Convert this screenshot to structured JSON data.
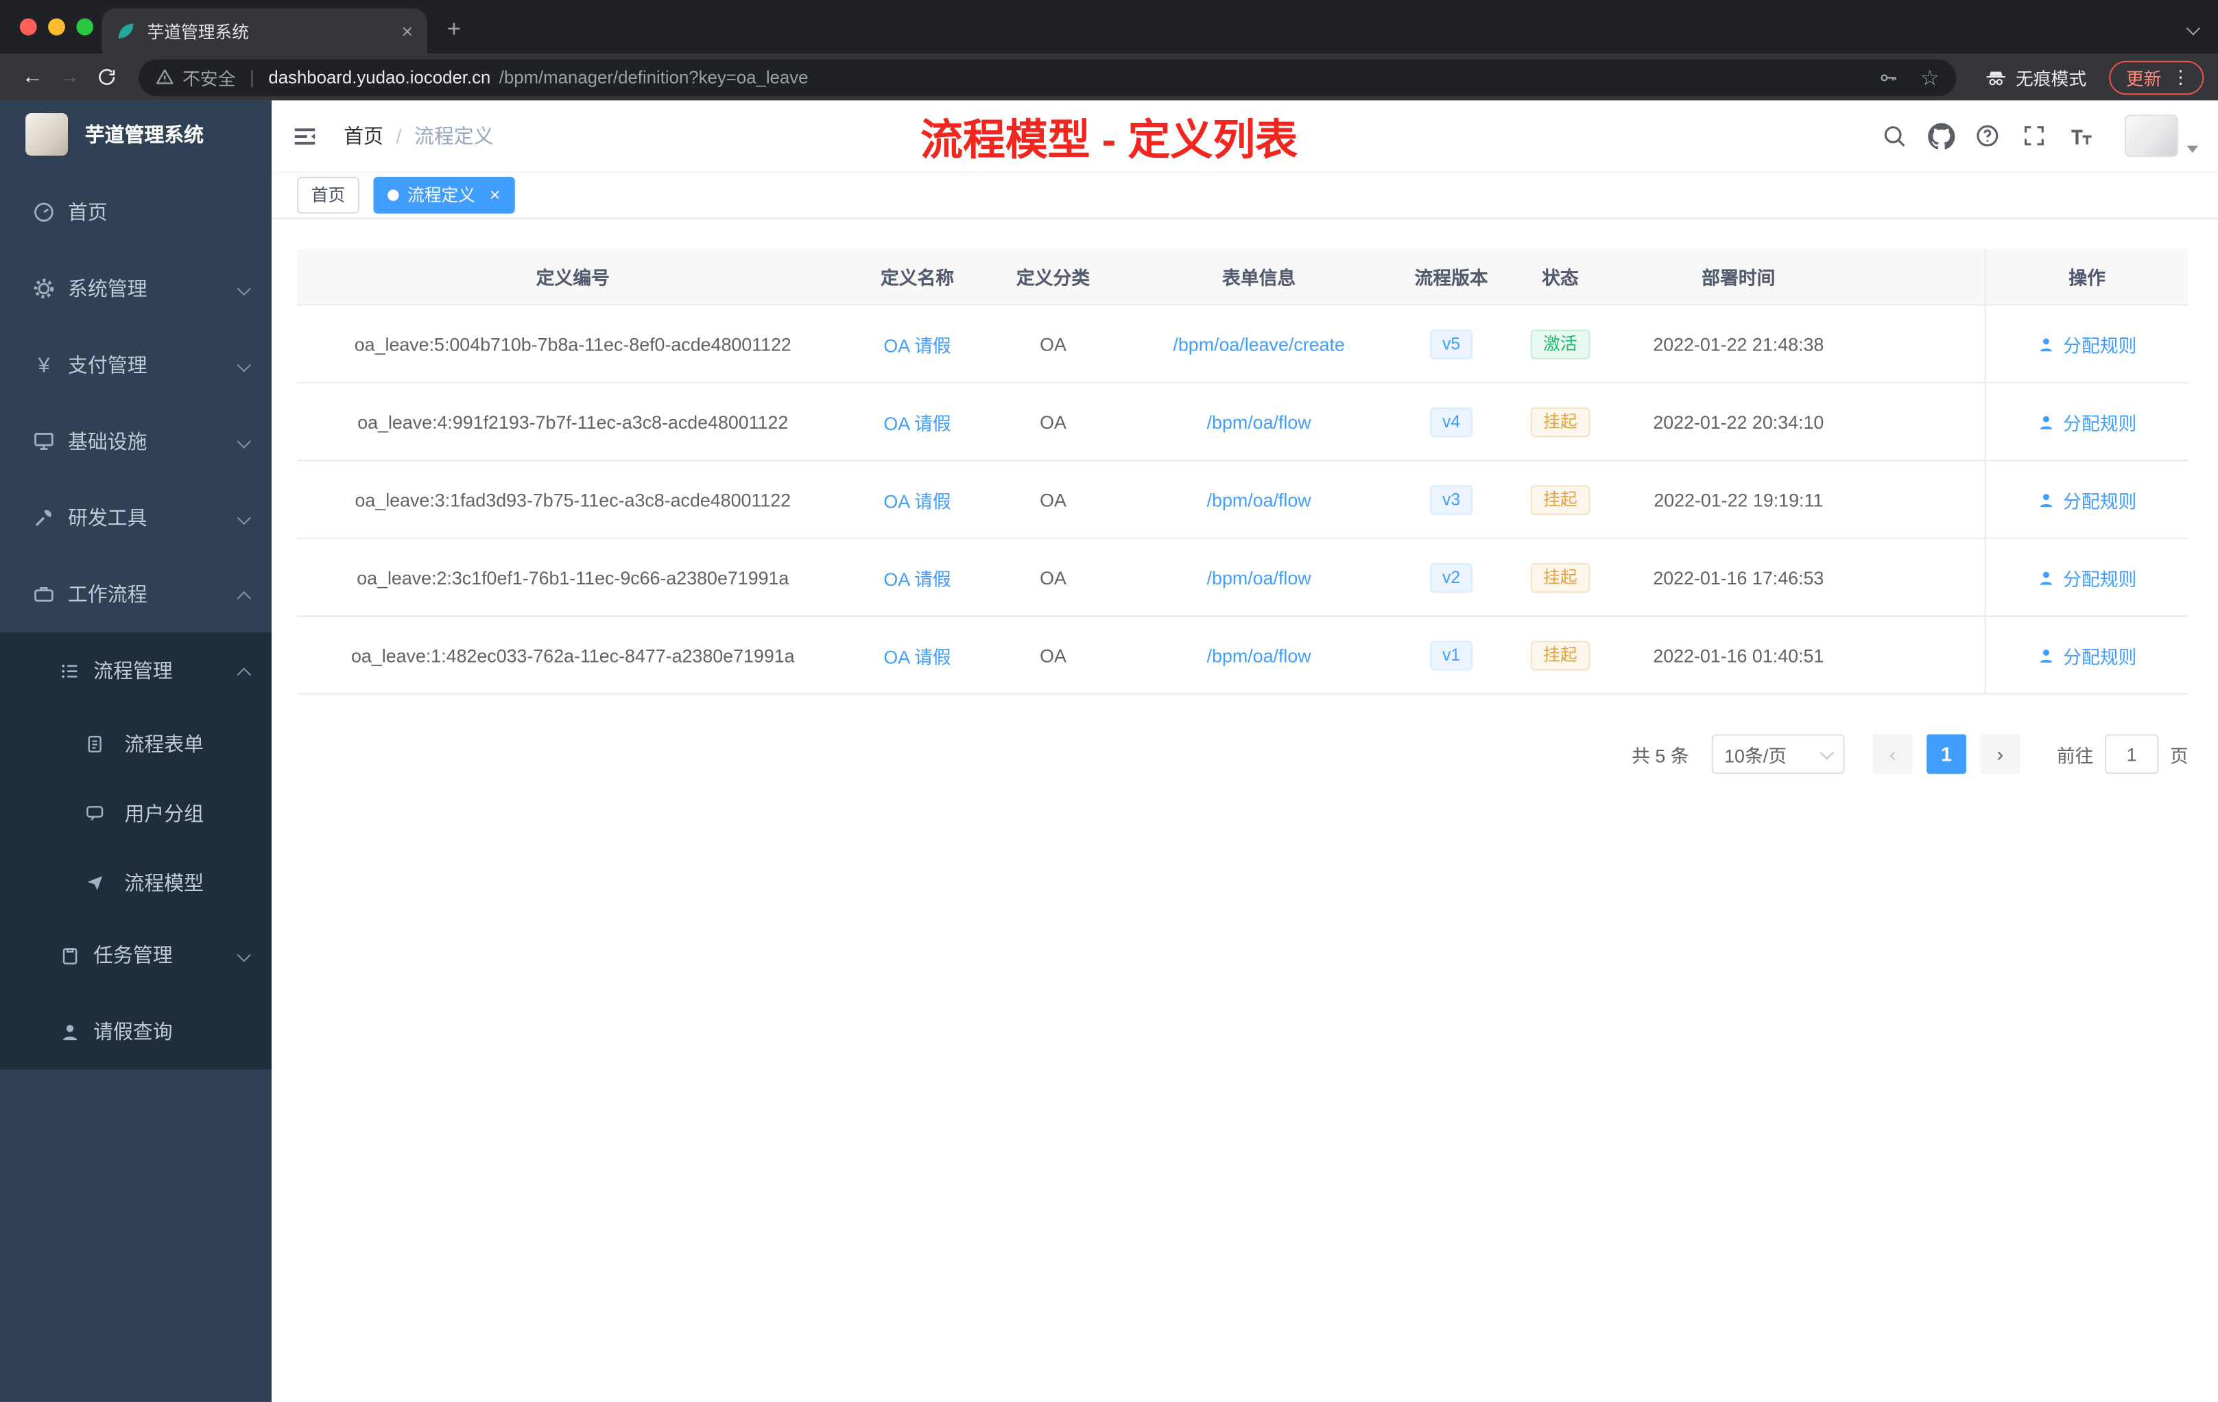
{
  "browser": {
    "tab_title": "芋道管理系统",
    "security_label": "不安全",
    "url_host": "dashboard.yudao.iocoder.cn",
    "url_path": "/bpm/manager/definition?key=oa_leave",
    "incognito_label": "无痕模式",
    "update_label": "更新"
  },
  "sidebar": {
    "logo_title": "芋道管理系统",
    "items": [
      {
        "label": "首页"
      },
      {
        "label": "系统管理"
      },
      {
        "label": "支付管理"
      },
      {
        "label": "基础设施"
      },
      {
        "label": "研发工具"
      },
      {
        "label": "工作流程"
      }
    ],
    "workflow": {
      "process_mgmt": {
        "label": "流程管理",
        "children": [
          {
            "label": "流程表单"
          },
          {
            "label": "用户分组"
          },
          {
            "label": "流程模型"
          }
        ]
      },
      "task_mgmt": {
        "label": "任务管理"
      },
      "leave_query": {
        "label": "请假查询"
      }
    }
  },
  "navbar": {
    "breadcrumb": [
      {
        "label": "首页"
      },
      {
        "label": "流程定义"
      }
    ],
    "annotation": "流程模型 - 定义列表"
  },
  "tags": [
    {
      "label": "首页"
    },
    {
      "label": "流程定义"
    }
  ],
  "table": {
    "columns": [
      "定义编号",
      "定义名称",
      "定义分类",
      "表单信息",
      "流程版本",
      "状态",
      "部署时间",
      "操作"
    ],
    "rows": [
      {
        "id": "oa_leave:5:004b710b-7b8a-11ec-8ef0-acde48001122",
        "name": "OA 请假",
        "category": "OA",
        "form": "/bpm/oa/leave/create",
        "version": "v5",
        "status": "激活",
        "deploy_time": "2022-01-22 21:48:38",
        "action": "分配规则"
      },
      {
        "id": "oa_leave:4:991f2193-7b7f-11ec-a3c8-acde48001122",
        "name": "OA 请假",
        "category": "OA",
        "form": "/bpm/oa/flow",
        "version": "v4",
        "status": "挂起",
        "deploy_time": "2022-01-22 20:34:10",
        "action": "分配规则"
      },
      {
        "id": "oa_leave:3:1fad3d93-7b75-11ec-a3c8-acde48001122",
        "name": "OA 请假",
        "category": "OA",
        "form": "/bpm/oa/flow",
        "version": "v3",
        "status": "挂起",
        "deploy_time": "2022-01-22 19:19:11",
        "action": "分配规则"
      },
      {
        "id": "oa_leave:2:3c1f0ef1-76b1-11ec-9c66-a2380e71991a",
        "name": "OA 请假",
        "category": "OA",
        "form": "/bpm/oa/flow",
        "version": "v2",
        "status": "挂起",
        "deploy_time": "2022-01-16 17:46:53",
        "action": "分配规则"
      },
      {
        "id": "oa_leave:1:482ec033-762a-11ec-8477-a2380e71991a",
        "name": "OA 请假",
        "category": "OA",
        "form": "/bpm/oa/flow",
        "version": "v1",
        "status": "挂起",
        "deploy_time": "2022-01-16 01:40:51",
        "action": "分配规则"
      }
    ]
  },
  "pagination": {
    "total": "共 5 条",
    "page_size": "10条/页",
    "current_page": "1",
    "goto_label": "前往",
    "goto_value": "1",
    "page_unit": "页"
  },
  "colors": {
    "accent": "#409eff",
    "success_text": "#19be6b",
    "warning_text": "#e6a23c",
    "annotation_red": "#f0261f",
    "sidebar_bg": "#304156"
  },
  "icons": {
    "back_arrow": "←",
    "forward_arrow": "→",
    "star": "☆",
    "plus": "+",
    "close": "×",
    "dots_vertical": "⋮",
    "breadcrumb_separator": "/"
  }
}
